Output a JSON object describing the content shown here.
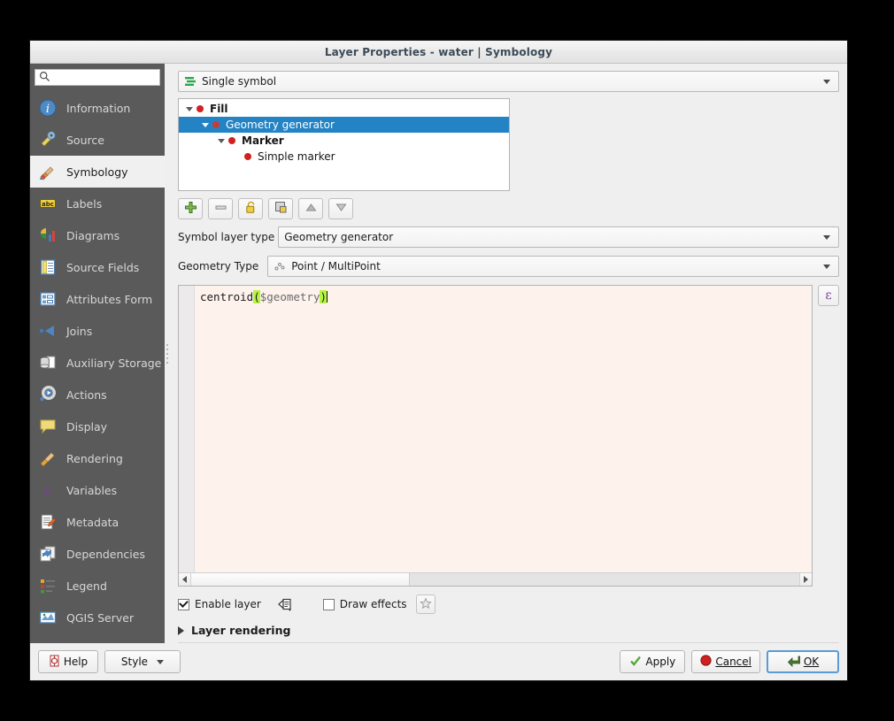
{
  "window": {
    "title": "Layer Properties - water | Symbology"
  },
  "sidebar": {
    "search_placeholder": "",
    "search_value": "",
    "items": [
      {
        "label": "Information",
        "icon": "information-icon"
      },
      {
        "label": "Source",
        "icon": "source-icon"
      },
      {
        "label": "Symbology",
        "icon": "symbology-icon"
      },
      {
        "label": "Labels",
        "icon": "labels-icon"
      },
      {
        "label": "Diagrams",
        "icon": "diagrams-icon"
      },
      {
        "label": "Source Fields",
        "icon": "source-fields-icon"
      },
      {
        "label": "Attributes Form",
        "icon": "attributes-form-icon"
      },
      {
        "label": "Joins",
        "icon": "joins-icon"
      },
      {
        "label": "Auxiliary Storage",
        "icon": "auxiliary-storage-icon"
      },
      {
        "label": "Actions",
        "icon": "actions-icon"
      },
      {
        "label": "Display",
        "icon": "display-icon"
      },
      {
        "label": "Rendering",
        "icon": "rendering-icon"
      },
      {
        "label": "Variables",
        "icon": "variables-icon"
      },
      {
        "label": "Metadata",
        "icon": "metadata-icon"
      },
      {
        "label": "Dependencies",
        "icon": "dependencies-icon"
      },
      {
        "label": "Legend",
        "icon": "legend-icon"
      },
      {
        "label": "QGIS Server",
        "icon": "qgis-server-icon"
      }
    ],
    "selected": "Symbology"
  },
  "main": {
    "renderer": {
      "value": "Single symbol",
      "icon": "single-symbol-icon"
    },
    "symbol_tree": [
      {
        "label": "Fill",
        "depth": 0,
        "bold": true,
        "expanded": true,
        "selected": false
      },
      {
        "label": "Geometry generator",
        "depth": 1,
        "bold": false,
        "expanded": true,
        "selected": true
      },
      {
        "label": "Marker",
        "depth": 2,
        "bold": true,
        "expanded": true,
        "selected": false
      },
      {
        "label": "Simple marker",
        "depth": 3,
        "bold": false,
        "expanded": false,
        "selected": false
      }
    ],
    "toolbar": [
      {
        "name": "add-symbol-layer-button",
        "icon": "plus-icon"
      },
      {
        "name": "remove-symbol-layer-button",
        "icon": "minus-icon"
      },
      {
        "name": "lock-layer-button",
        "icon": "padlock-icon"
      },
      {
        "name": "duplicate-layer-button",
        "icon": "duplicate-icon"
      },
      {
        "name": "move-up-button",
        "icon": "triangle-up-icon"
      },
      {
        "name": "move-down-button",
        "icon": "triangle-down-icon"
      }
    ],
    "symbol_layer_type": {
      "label": "Symbol layer type",
      "value": "Geometry generator"
    },
    "geometry_type": {
      "label": "Geometry Type",
      "value": "Point / MultiPoint",
      "icon": "multipoint-icon"
    },
    "expression": {
      "text": "centroid($geometry)",
      "function_name": "centroid",
      "open_paren": "(",
      "argument": "$geometry",
      "close_paren": ")",
      "expression_button_glyph": "ε"
    },
    "options": {
      "enable_layer_label": "Enable layer",
      "enable_layer_checked": true,
      "draw_effects_label": "Draw effects",
      "draw_effects_checked": false
    },
    "layer_rendering": {
      "label": "Layer rendering",
      "expanded": false
    }
  },
  "buttons": {
    "help": "Help",
    "style": "Style",
    "apply": "Apply",
    "cancel": "Cancel",
    "ok": "OK"
  },
  "colors": {
    "selection_blue": "#2383c4",
    "sidebar_bg": "#5a5a5a",
    "dialog_bg": "#efefef",
    "symbol_dot_red": "#d22020",
    "expression_bg": "#fdf2ec",
    "highlight_green": "#b6f442",
    "accent_purple": "#7a3f8f",
    "title_text": "#3d4a56"
  }
}
